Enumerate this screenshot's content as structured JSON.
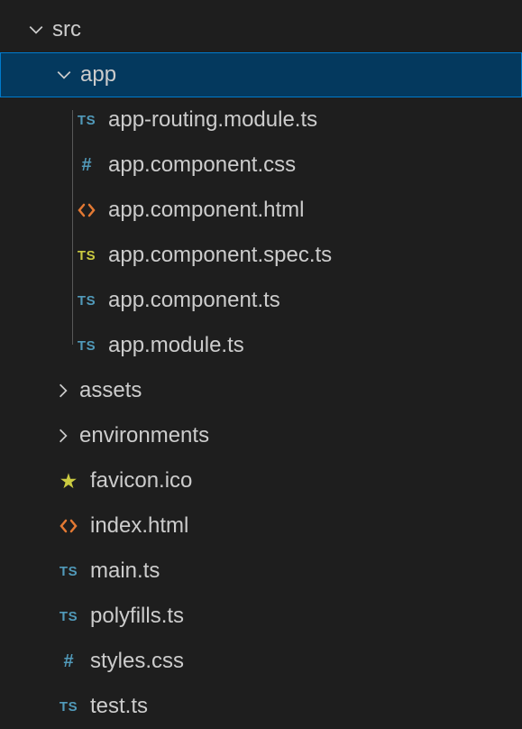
{
  "tree": {
    "src": {
      "label": "src",
      "expanded": true
    },
    "app": {
      "label": "app",
      "expanded": true,
      "selected": true
    },
    "assets": {
      "label": "assets",
      "expanded": false
    },
    "environments": {
      "label": "environments",
      "expanded": false
    },
    "files": {
      "app_routing_module": {
        "label": "app-routing.module.ts",
        "icon": "TS",
        "iconType": "ts"
      },
      "app_component_css": {
        "label": "app.component.css",
        "icon": "#",
        "iconType": "hash"
      },
      "app_component_html": {
        "label": "app.component.html",
        "icon": "<>",
        "iconType": "html"
      },
      "app_component_spec": {
        "label": "app.component.spec.ts",
        "icon": "TS",
        "iconType": "ts-spec"
      },
      "app_component_ts": {
        "label": "app.component.ts",
        "icon": "TS",
        "iconType": "ts"
      },
      "app_module": {
        "label": "app.module.ts",
        "icon": "TS",
        "iconType": "ts"
      },
      "favicon": {
        "label": "favicon.ico",
        "icon": "★",
        "iconType": "star"
      },
      "index_html": {
        "label": "index.html",
        "icon": "<>",
        "iconType": "html"
      },
      "main_ts": {
        "label": "main.ts",
        "icon": "TS",
        "iconType": "ts"
      },
      "polyfills_ts": {
        "label": "polyfills.ts",
        "icon": "TS",
        "iconType": "ts"
      },
      "styles_css": {
        "label": "styles.css",
        "icon": "#",
        "iconType": "hash"
      },
      "test_ts": {
        "label": "test.ts",
        "icon": "TS",
        "iconType": "ts"
      }
    }
  }
}
